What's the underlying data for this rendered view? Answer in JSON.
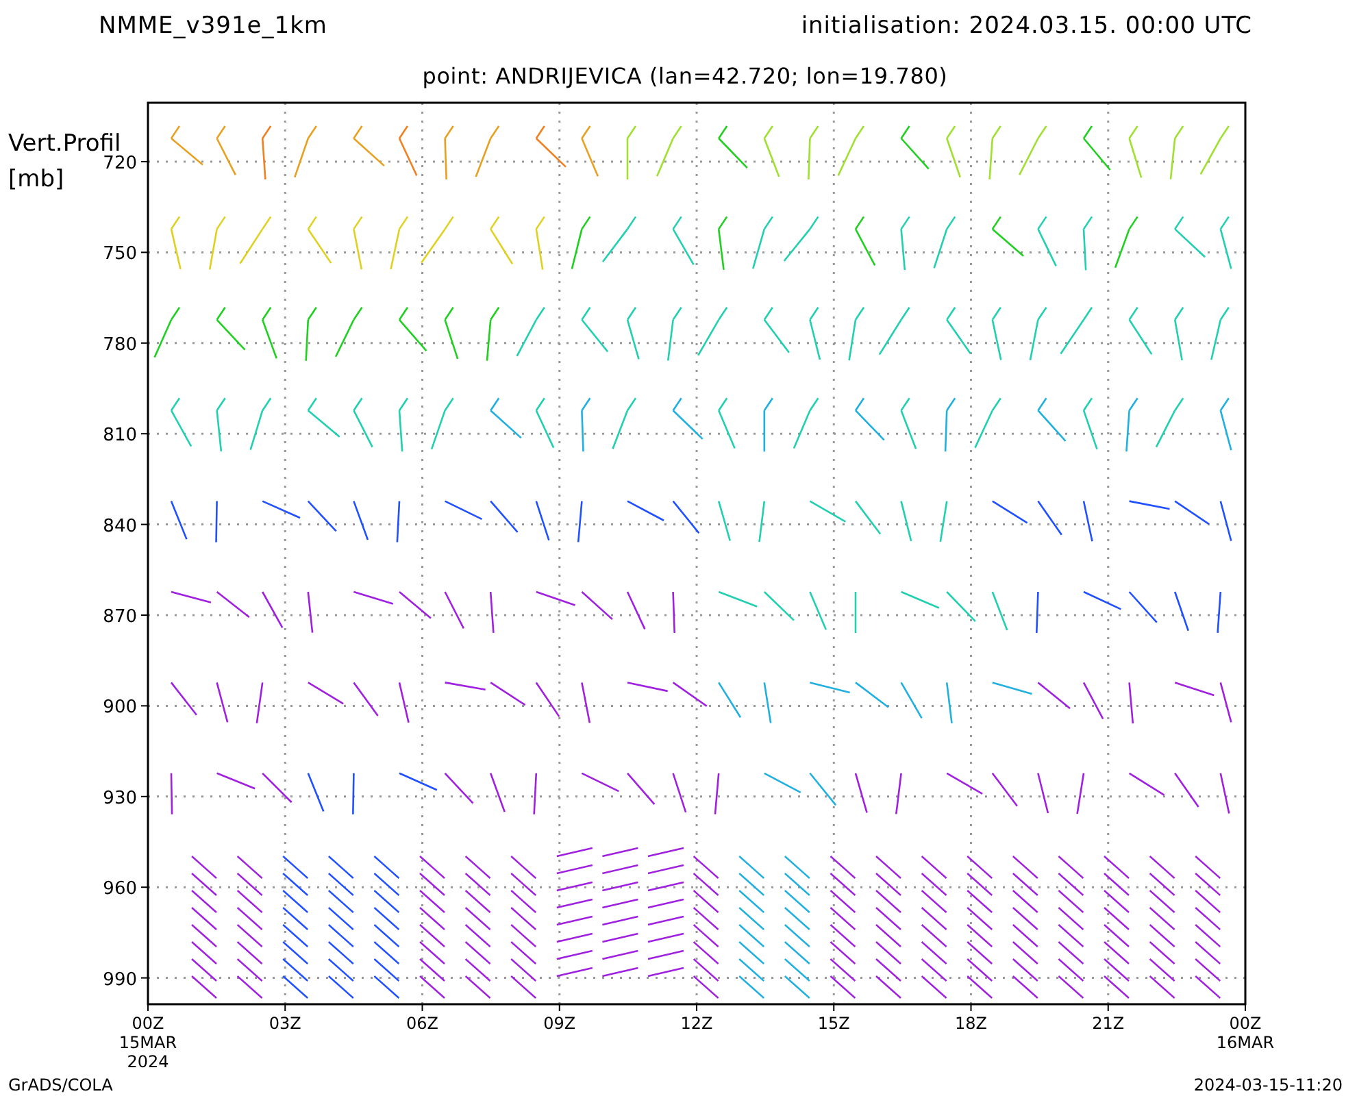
{
  "header": {
    "model": "NMME_v391e_1km",
    "initialisation": "initialisation: 2024.03.15. 00:00 UTC"
  },
  "subtitle": "point: ANDRIJEVICA (lan=42.720; lon=19.780)",
  "y_axis": {
    "title_lines": [
      "Vert.Profil",
      "[mb]"
    ],
    "ticks": [
      "720",
      "750",
      "780",
      "810",
      "840",
      "870",
      "900",
      "930",
      "960",
      "990"
    ]
  },
  "x_axis": {
    "ticks": [
      {
        "lines": [
          "00Z",
          "15MAR",
          "2024"
        ]
      },
      {
        "lines": [
          "03Z"
        ]
      },
      {
        "lines": [
          "06Z"
        ]
      },
      {
        "lines": [
          "09Z"
        ]
      },
      {
        "lines": [
          "12Z"
        ]
      },
      {
        "lines": [
          "15Z"
        ]
      },
      {
        "lines": [
          "18Z"
        ]
      },
      {
        "lines": [
          "21Z"
        ]
      },
      {
        "lines": [
          "00Z",
          "16MAR"
        ]
      }
    ]
  },
  "footer": {
    "left": "GrADS/COLA",
    "right": "2024-03-15-11:20"
  }
}
